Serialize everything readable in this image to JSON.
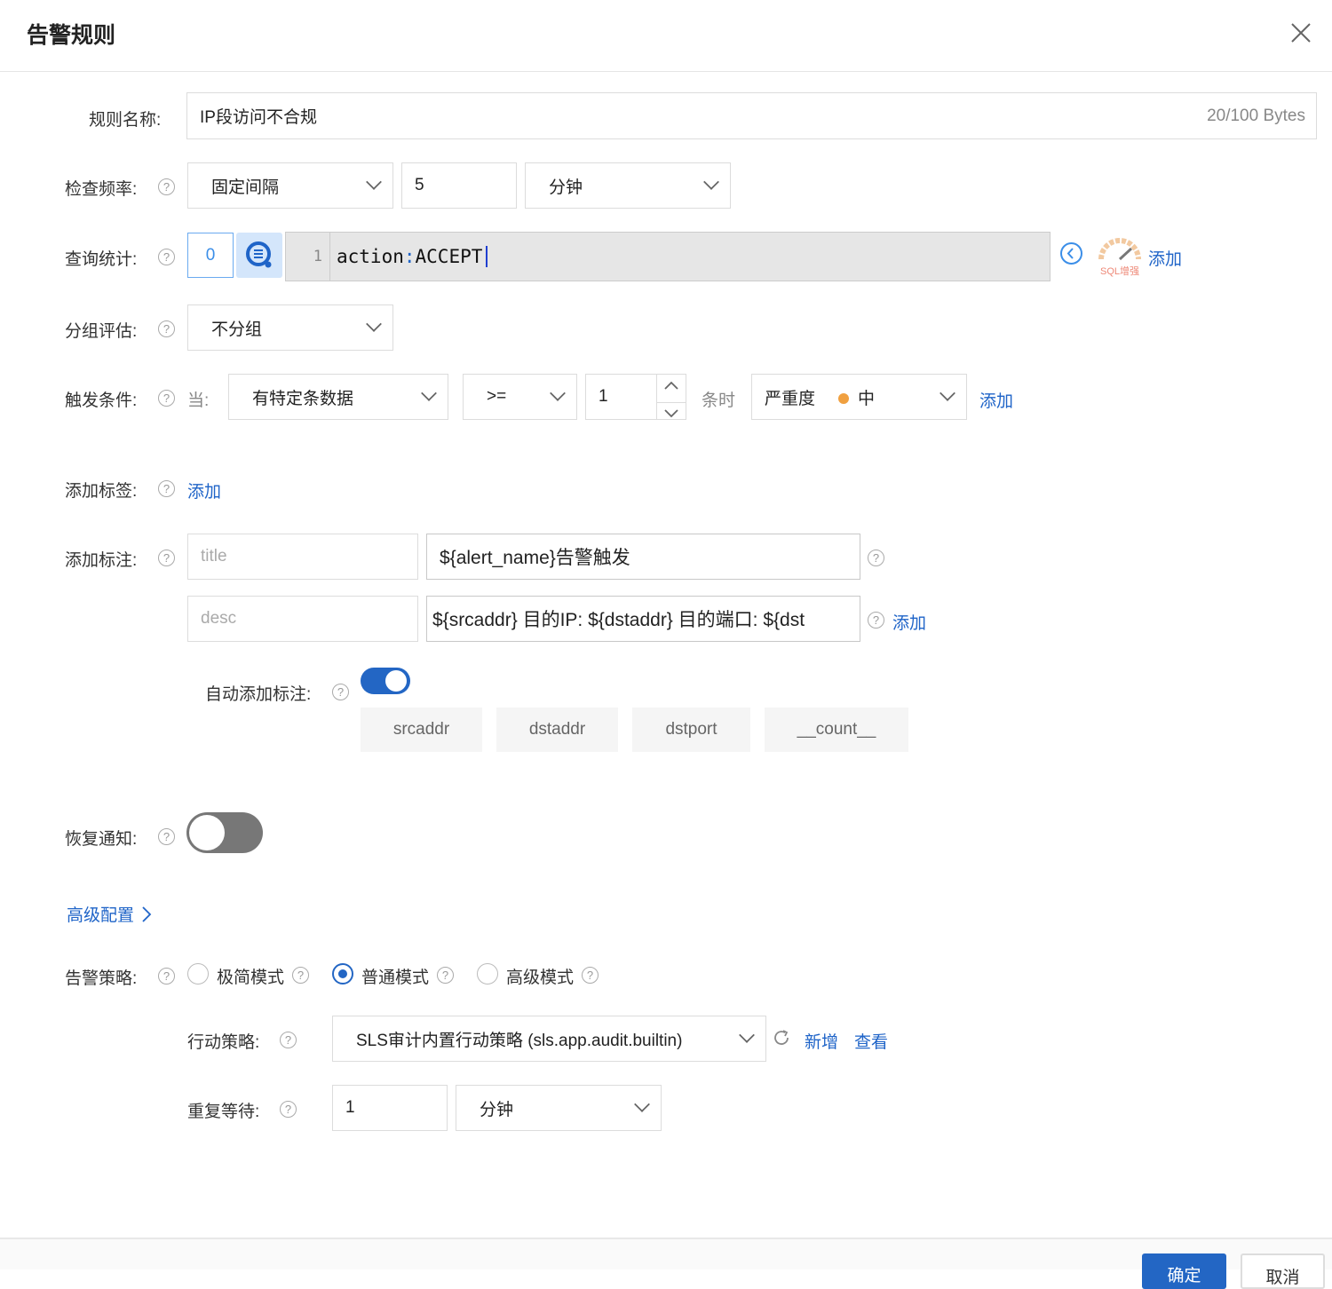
{
  "dialog": {
    "title": "告警规则"
  },
  "rule_name": {
    "label": "规则名称:",
    "value": "IP段访问不合规",
    "counter": "20/100 Bytes"
  },
  "check_freq": {
    "label": "检查频率:",
    "mode": "固定间隔",
    "value": "5",
    "unit": "分钟"
  },
  "query": {
    "label": "查询统计:",
    "index": "0",
    "line_no": "1",
    "code_key": "action",
    "code_sep": ":",
    "code_val": "ACCEPT",
    "sql_badge": "SQL增强",
    "add": "添加"
  },
  "group": {
    "label": "分组评估:",
    "value": "不分组"
  },
  "trigger": {
    "label": "触发条件:",
    "when": "当:",
    "condition": "有特定条数据",
    "operator": ">=",
    "count": "1",
    "suffix": "条时",
    "severity_label": "严重度",
    "severity": "中",
    "severity_color": "#f0a040",
    "add": "添加"
  },
  "tags": {
    "label": "添加标签:",
    "add": "添加"
  },
  "annotations": {
    "label": "添加标注:",
    "rows": [
      {
        "key_placeholder": "title",
        "value": "${alert_name}告警触发"
      },
      {
        "key_placeholder": "desc",
        "value": "${srcaddr} 目的IP: ${dstaddr} 目的端口: ${dst"
      }
    ],
    "add": "添加"
  },
  "auto_annot": {
    "label": "自动添加标注:",
    "enabled": true,
    "fields": [
      "srcaddr",
      "dstaddr",
      "dstport",
      "__count__"
    ]
  },
  "recovery": {
    "label": "恢复通知:",
    "enabled": false
  },
  "advanced": {
    "label": "高级配置"
  },
  "policy": {
    "label": "告警策略:",
    "modes": [
      "极简模式",
      "普通模式",
      "高级模式"
    ],
    "selected": "普通模式"
  },
  "action_policy": {
    "label": "行动策略:",
    "value": "SLS审计内置行动策略 (sls.app.audit.builtin)",
    "new": "新增",
    "view": "查看"
  },
  "repeat": {
    "label": "重复等待:",
    "value": "1",
    "unit": "分钟"
  },
  "footer": {
    "ok": "确定",
    "cancel": "取消"
  },
  "colors": {
    "accent": "#2366c4",
    "link": "#1f64c8"
  }
}
